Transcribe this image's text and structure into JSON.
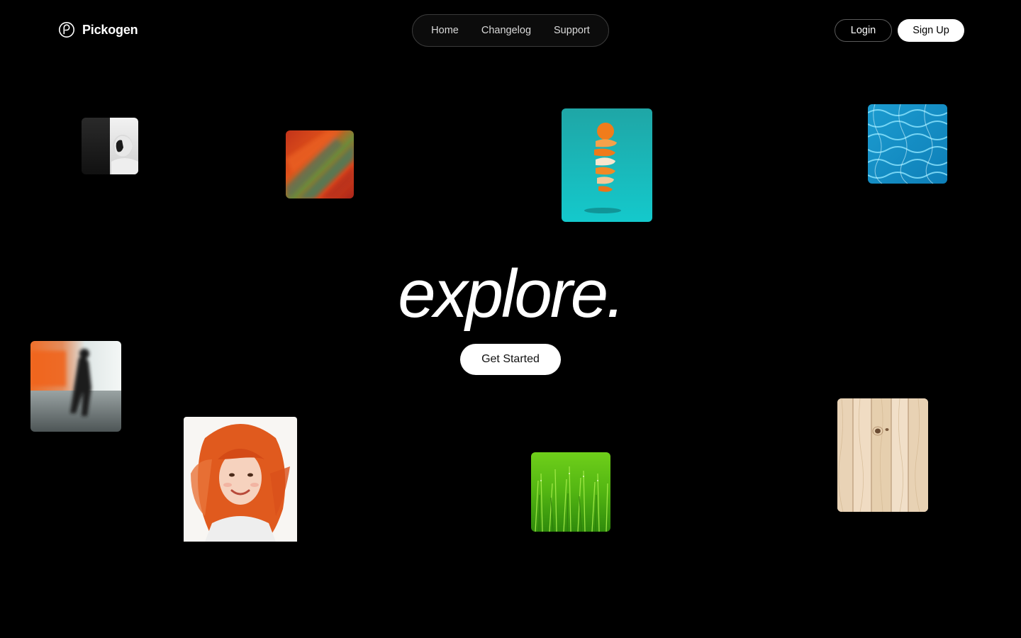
{
  "header": {
    "brand_name": "Pickogen",
    "brand_icon": "pickogen-logo-icon",
    "nav": [
      {
        "label": "Home"
      },
      {
        "label": "Changelog"
      },
      {
        "label": "Support"
      }
    ],
    "login_label": "Login",
    "signup_label": "Sign Up"
  },
  "hero": {
    "title": "explore.",
    "cta_label": "Get Started"
  },
  "gallery": {
    "images": [
      {
        "subject": "bw-hooded-profile"
      },
      {
        "subject": "blurred-abstract"
      },
      {
        "subject": "orange-peel-spiral"
      },
      {
        "subject": "pool-water-ripples"
      },
      {
        "subject": "motion-blur-walker"
      },
      {
        "subject": "redhead-watercolor-portrait"
      },
      {
        "subject": "green-grass-dew"
      },
      {
        "subject": "light-wood-planks"
      }
    ]
  },
  "colors": {
    "background": "#000000",
    "text": "#ffffff",
    "nav_border": "#3a3a3a",
    "button_primary": "#ffffff"
  }
}
